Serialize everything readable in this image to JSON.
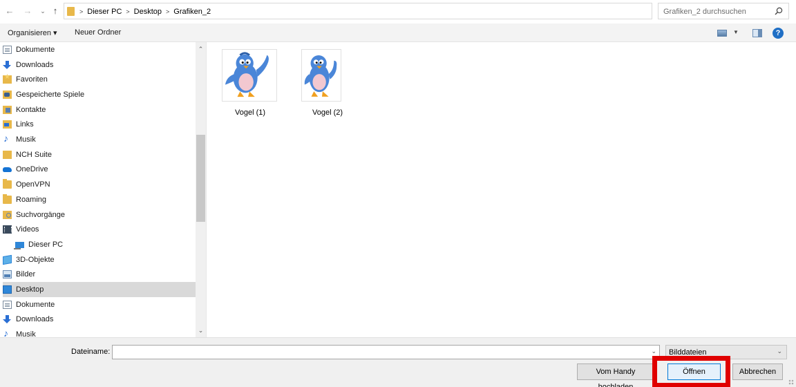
{
  "address": {
    "crumbs": [
      "Dieser PC",
      "Desktop",
      "Grafiken_2"
    ],
    "search_placeholder": "Grafiken_2 durchsuchen"
  },
  "toolbar": {
    "organize_label": "Organisieren ▾",
    "new_folder_label": "Neuer Ordner"
  },
  "nav": {
    "items": [
      {
        "label": "Dokumente",
        "icon": "document-icon"
      },
      {
        "label": "Downloads",
        "icon": "download-icon"
      },
      {
        "label": "Favoriten",
        "icon": "favorites-folder-icon"
      },
      {
        "label": "Gespeicherte Spiele",
        "icon": "saved-games-icon"
      },
      {
        "label": "Kontakte",
        "icon": "contacts-icon"
      },
      {
        "label": "Links",
        "icon": "links-icon"
      },
      {
        "label": "Musik",
        "icon": "music-icon"
      },
      {
        "label": "NCH Suite",
        "icon": "folder-icon"
      },
      {
        "label": "OneDrive",
        "icon": "onedrive-cloud-icon"
      },
      {
        "label": "OpenVPN",
        "icon": "folder-icon"
      },
      {
        "label": "Roaming",
        "icon": "folder-icon"
      },
      {
        "label": "Suchvorgänge",
        "icon": "searches-folder-icon"
      },
      {
        "label": "Videos",
        "icon": "video-icon"
      },
      {
        "label": "Dieser PC",
        "icon": "this-pc-icon"
      },
      {
        "label": "3D-Objekte",
        "icon": "3d-objects-icon"
      },
      {
        "label": "Bilder",
        "icon": "pictures-icon"
      },
      {
        "label": "Desktop",
        "icon": "desktop-icon"
      },
      {
        "label": "Dokumente",
        "icon": "document-icon"
      },
      {
        "label": "Downloads",
        "icon": "download-icon"
      },
      {
        "label": "Musik",
        "icon": "music-icon"
      }
    ],
    "selected": "Desktop"
  },
  "files": [
    {
      "name": "Vogel (1)",
      "icon": "bird-image-icon"
    },
    {
      "name": "Vogel (2)",
      "icon": "bird-image-icon"
    }
  ],
  "bottom": {
    "filename_label": "Dateiname:",
    "filename_value": "",
    "filetype_value": "Bilddateien",
    "phone_upload_label": "Vom Handy hochladen",
    "open_label": "Öffnen",
    "cancel_label": "Abbrechen"
  },
  "colors": {
    "highlight_frame": "#e00000",
    "accent": "#0078d7",
    "folder": "#e8b84a"
  }
}
